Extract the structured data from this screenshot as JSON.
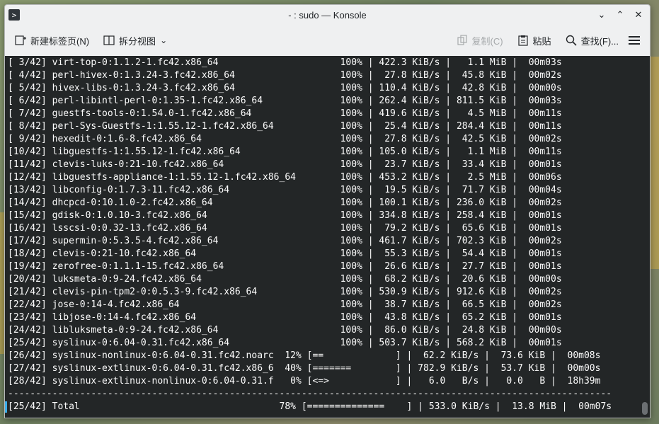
{
  "window": {
    "title": "- : sudo — Konsole"
  },
  "toolbar": {
    "new_tab": "新建标签页(N)",
    "split_view": "拆分视图",
    "copy": "复制(C)",
    "paste": "粘贴",
    "find": "查找(F)..."
  },
  "terminal": {
    "lines": [
      "[ 3/42] virt-top-0:1.1.2-1.fc42.x86_64                      100% | 422.3 KiB/s |   1.1 MiB |  00m03s",
      "[ 4/42] perl-hivex-0:1.3.24-3.fc42.x86_64                   100% |  27.8 KiB/s |  45.8 KiB |  00m02s",
      "[ 5/42] hivex-libs-0:1.3.24-3.fc42.x86_64                   100% | 110.4 KiB/s |  42.8 KiB |  00m00s",
      "[ 6/42] perl-libintl-perl-0:1.35-1.fc42.x86_64              100% | 262.4 KiB/s | 811.5 KiB |  00m03s",
      "[ 7/42] guestfs-tools-0:1.54.0-1.fc42.x86_64                100% | 419.6 KiB/s |   4.5 MiB |  00m11s",
      "[ 8/42] perl-Sys-Guestfs-1:1.55.12-1.fc42.x86_64            100% |  25.4 KiB/s | 284.4 KiB |  00m11s",
      "[ 9/42] hexedit-0:1.6-8.fc42.x86_64                         100% |  27.8 KiB/s |  42.5 KiB |  00m02s",
      "[10/42] libguestfs-1:1.55.12-1.fc42.x86_64                  100% | 105.0 KiB/s |   1.1 MiB |  00m11s",
      "[11/42] clevis-luks-0:21-10.fc42.x86_64                     100% |  23.7 KiB/s |  33.4 KiB |  00m01s",
      "[12/42] libguestfs-appliance-1:1.55.12-1.fc42.x86_64        100% | 453.2 KiB/s |   2.5 MiB |  00m06s",
      "[13/42] libconfig-0:1.7.3-11.fc42.x86_64                    100% |  19.5 KiB/s |  71.7 KiB |  00m04s",
      "[14/42] dhcpcd-0:10.1.0-2.fc42.x86_64                       100% | 100.1 KiB/s | 236.0 KiB |  00m02s",
      "[15/42] gdisk-0:1.0.10-3.fc42.x86_64                        100% | 334.8 KiB/s | 258.4 KiB |  00m01s",
      "[16/42] lsscsi-0:0.32-13.fc42.x86_64                        100% |  79.2 KiB/s |  65.6 KiB |  00m01s",
      "[17/42] supermin-0:5.3.5-4.fc42.x86_64                      100% | 461.7 KiB/s | 702.3 KiB |  00m02s",
      "[18/42] clevis-0:21-10.fc42.x86_64                          100% |  55.3 KiB/s |  54.4 KiB |  00m01s",
      "[19/42] zerofree-0:1.1.1-15.fc42.x86_64                     100% |  26.6 KiB/s |  27.7 KiB |  00m01s",
      "[20/42] luksmeta-0:9-24.fc42.x86_64                         100% |  68.2 KiB/s |  20.6 KiB |  00m00s",
      "[21/42] clevis-pin-tpm2-0:0.5.3-9.fc42.x86_64               100% | 530.9 KiB/s | 912.6 KiB |  00m02s",
      "[22/42] jose-0:14-4.fc42.x86_64                             100% |  38.7 KiB/s |  66.5 KiB |  00m02s",
      "[23/42] libjose-0:14-4.fc42.x86_64                          100% |  43.8 KiB/s |  65.2 KiB |  00m01s",
      "[24/42] libluksmeta-0:9-24.fc42.x86_64                      100% |  86.0 KiB/s |  24.8 KiB |  00m00s",
      "[25/42] syslinux-0:6.04-0.31.fc42.x86_64                    100% | 503.7 KiB/s | 568.2 KiB |  00m01s",
      "[26/42] syslinux-nonlinux-0:6.04-0.31.fc42.noarc  12% [==             ] |  62.2 KiB/s |  73.6 KiB |  00m08s",
      "[27/42] syslinux-extlinux-0:6.04-0.31.fc42.x86_6  40% [=======        ] | 782.9 KiB/s |  53.7 KiB |  00m00s",
      "[28/42] syslinux-extlinux-nonlinux-0:6.04-0.31.f   0% [<=>            ] |   6.0   B/s |   0.0   B |  18h39m",
      "-------------------------------------------------------------------------------------------------------------",
      "[25/42] Total                                    78% [==============    ] | 533.0 KiB/s |  13.8 MiB |  00m07s"
    ]
  },
  "colors": {
    "terminal_bg": "#232627",
    "accent": "#3daee9"
  }
}
